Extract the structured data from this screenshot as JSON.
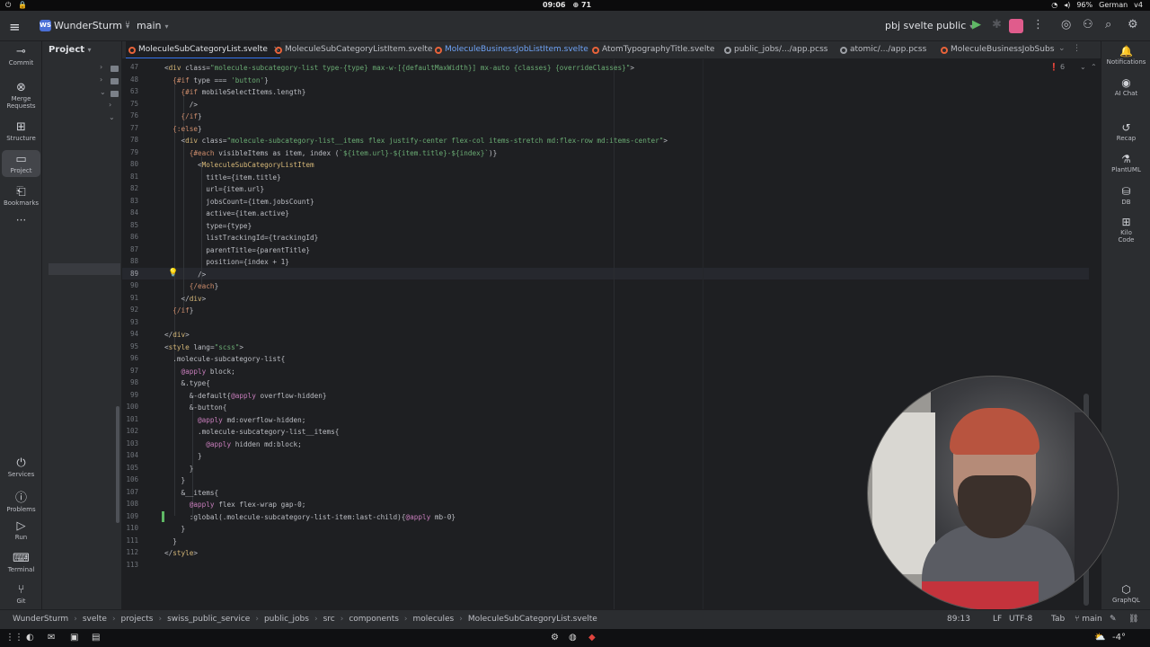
{
  "os": {
    "time": "09:06",
    "notif_count": "71",
    "battery": "96%",
    "keyboard": "German",
    "version": "v4"
  },
  "header": {
    "project_badge": "WS",
    "project_name": "WunderSturm",
    "branch": "main",
    "run_config": "pbj svelte public"
  },
  "left_tools": [
    {
      "label": "Commit",
      "icon": "commit-icon"
    },
    {
      "label": "Merge Requests",
      "icon": "merge-icon"
    },
    {
      "label": "Structure",
      "icon": "structure-icon"
    },
    {
      "label": "Project",
      "icon": "folder-icon"
    },
    {
      "label": "Bookmarks",
      "icon": "bookmark-icon"
    },
    {
      "label": "Services",
      "icon": "services-icon"
    },
    {
      "label": "Problems",
      "icon": "problems-icon"
    },
    {
      "label": "Run",
      "icon": "run-icon"
    },
    {
      "label": "Terminal",
      "icon": "terminal-icon"
    },
    {
      "label": "Git",
      "icon": "git-icon"
    }
  ],
  "project_panel": {
    "title": "Project"
  },
  "tabs": [
    {
      "label": "MoleculeSubCategoryList.svelte",
      "active": true
    },
    {
      "label": "MoleculeSubCategoryListItem.svelte"
    },
    {
      "label": "MoleculeBusinessJobListItem.svelte"
    },
    {
      "label": "AtomTypographyTitle.svelte"
    },
    {
      "label": "public_jobs/.../app.pcss"
    },
    {
      "label": "atomic/.../app.pcss"
    },
    {
      "label": "MoleculeBusinessJobSubscri"
    }
  ],
  "editor": {
    "warnings": "6",
    "line_numbers": [
      "47",
      "48",
      "63",
      "75",
      "76",
      "77",
      "78",
      "79",
      "80",
      "81",
      "82",
      "83",
      "84",
      "85",
      "86",
      "87",
      "88",
      "89",
      "90",
      "91",
      "92",
      "93",
      "94",
      "95",
      "96",
      "97",
      "98",
      "99",
      "100",
      "101",
      "102",
      "103",
      "104",
      "105",
      "106",
      "107",
      "108",
      "109",
      "110",
      "111",
      "112",
      "113"
    ],
    "code_lines": [
      "<div class=\"molecule-subcategory-list type-{type} max-w-[{defaultMaxWidth}] mx-auto {classes} {overrideClasses}\">",
      "  {#if type === 'button'}",
      "    {#if mobileSelectItems.length}",
      "      />",
      "    {/if}",
      "  {:else}",
      "    <div class=\"molecule-subcategory-list__items flex justify-center flex-col items-stretch md:flex-row md:items-center\">",
      "      {#each visibleItems as item, index (`${item.url}-${item.title}-${index}`)}",
      "        <MoleculeSubCategoryListItem",
      "          title={item.title}",
      "          url={item.url}",
      "          jobsCount={item.jobsCount}",
      "          active={item.active}",
      "          type={type}",
      "          listTrackingId={trackingId}",
      "          parentTitle={parentTitle}",
      "          position={index + 1}",
      "        />",
      "      {/each}",
      "    </div>",
      "  {/if}",
      "",
      "</div>",
      "<style lang=\"scss\">",
      "  .molecule-subcategory-list{",
      "    @apply block;",
      "    &.type{",
      "      &-default{@apply overflow-hidden}",
      "      &-button{",
      "        @apply md:overflow-hidden;",
      "        .molecule-subcategory-list__items{",
      "          @apply hidden md:block;",
      "        }",
      "      }",
      "    }",
      "    &__items{",
      "      @apply flex flex-wrap gap-0;",
      "      :global(.molecule-subcategory-list-item:last-child){@apply mb-0}",
      "    }",
      "  }",
      "</style>",
      ""
    ]
  },
  "right_tools": [
    {
      "label": "Notifications",
      "icon": "bell-icon"
    },
    {
      "label": "AI Chat",
      "icon": "ai-chat-icon"
    },
    {
      "label": "Recap",
      "icon": "recap-icon"
    },
    {
      "label": "PlantUML",
      "icon": "plantuml-icon"
    },
    {
      "label": "DB",
      "icon": "database-icon"
    },
    {
      "label": "Kilo Code",
      "icon": "kilo-code-icon"
    },
    {
      "label": "GraphQL",
      "icon": "graphql-icon"
    }
  ],
  "breadcrumbs": [
    "WunderSturm",
    "svelte",
    "projects",
    "swiss_public_service",
    "public_jobs",
    "src",
    "components",
    "molecules",
    "MoleculeSubCategoryList.svelte"
  ],
  "status": {
    "position": "89:13",
    "line_sep": "LF",
    "encoding": "UTF-8",
    "indent": "Tab",
    "branch": "main"
  },
  "taskbar": {
    "temp": "-4°"
  }
}
